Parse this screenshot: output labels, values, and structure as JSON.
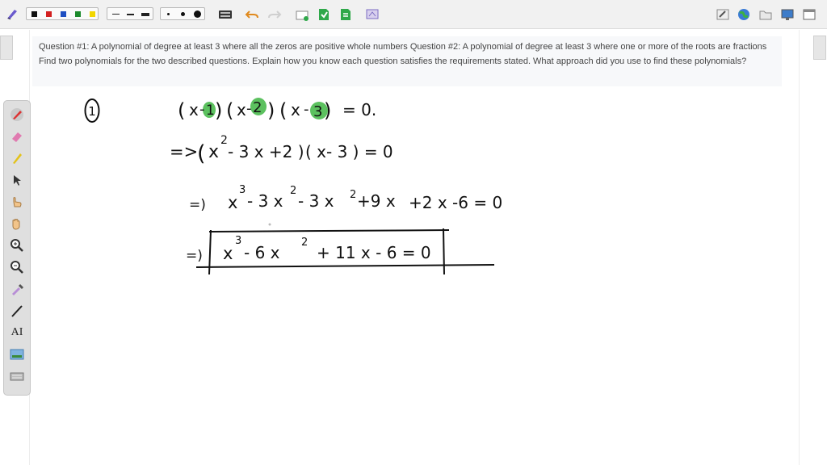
{
  "question": {
    "text": "Question #1: A polynomial of degree at least 3 where all the zeros are positive whole numbers Question #2: A polynomial of degree at least 3 where one or more of the roots are fractions Find two polynomials for the two described questions. Explain how you know each question satisfies the requirements stated. What approach did you use to find these polynomials?"
  },
  "toolbar": {
    "colors": [
      "#111111",
      "#d32020",
      "#1f4fc2",
      "#1c8a2c",
      "#f2d600"
    ],
    "tools": [
      "pen-tool-icon",
      "undo-icon",
      "redo-icon",
      "new-page-icon",
      "add-page-icon",
      "page-icon",
      "screen-capture-icon"
    ],
    "right_tools": [
      "edit-icon",
      "globe-icon",
      "folder-icon",
      "monitor-icon",
      "window-icon"
    ]
  },
  "left_tools": {
    "text_tool_label": "AI"
  },
  "handwriting": {
    "question_number": "1",
    "line1": {
      "arrow": "",
      "open1": "(",
      "x1": "x",
      "minus1": "-",
      "root1": "1",
      "close1": ")",
      "open2": "(",
      "x2": "x",
      "minus2": "-",
      "root2": "2",
      "close2": ")",
      "open3": "(",
      "x3": "x",
      "minus3": "-",
      "root3": "3",
      "close3": ")",
      "equals": "= 0."
    },
    "line2": {
      "arrow": "=>",
      "paren_open": "(",
      "x_base": "x",
      "exp": "2",
      "rest": "- 3 x +2 )",
      "factor": "( x- 3 ) = 0"
    },
    "line3": {
      "arrow": "=)",
      "x_base": "x",
      "exp1": "3",
      "t2": "- 3 x",
      "exp2": "2",
      "t3": "- 3 x",
      "exp3": "2",
      "t4": "+9 x",
      "t5": "+2 x -6 = 0"
    },
    "line4": {
      "arrow": "=)",
      "x_base": "x",
      "exp1": "3",
      "t2": "- 6 x",
      "exp2": "2",
      "t3": "+ 11 x - 6 = 0"
    }
  },
  "colors": {
    "highlight": "#5cc15f",
    "ink": "#111111",
    "question_bg": "#f7f8fa"
  }
}
